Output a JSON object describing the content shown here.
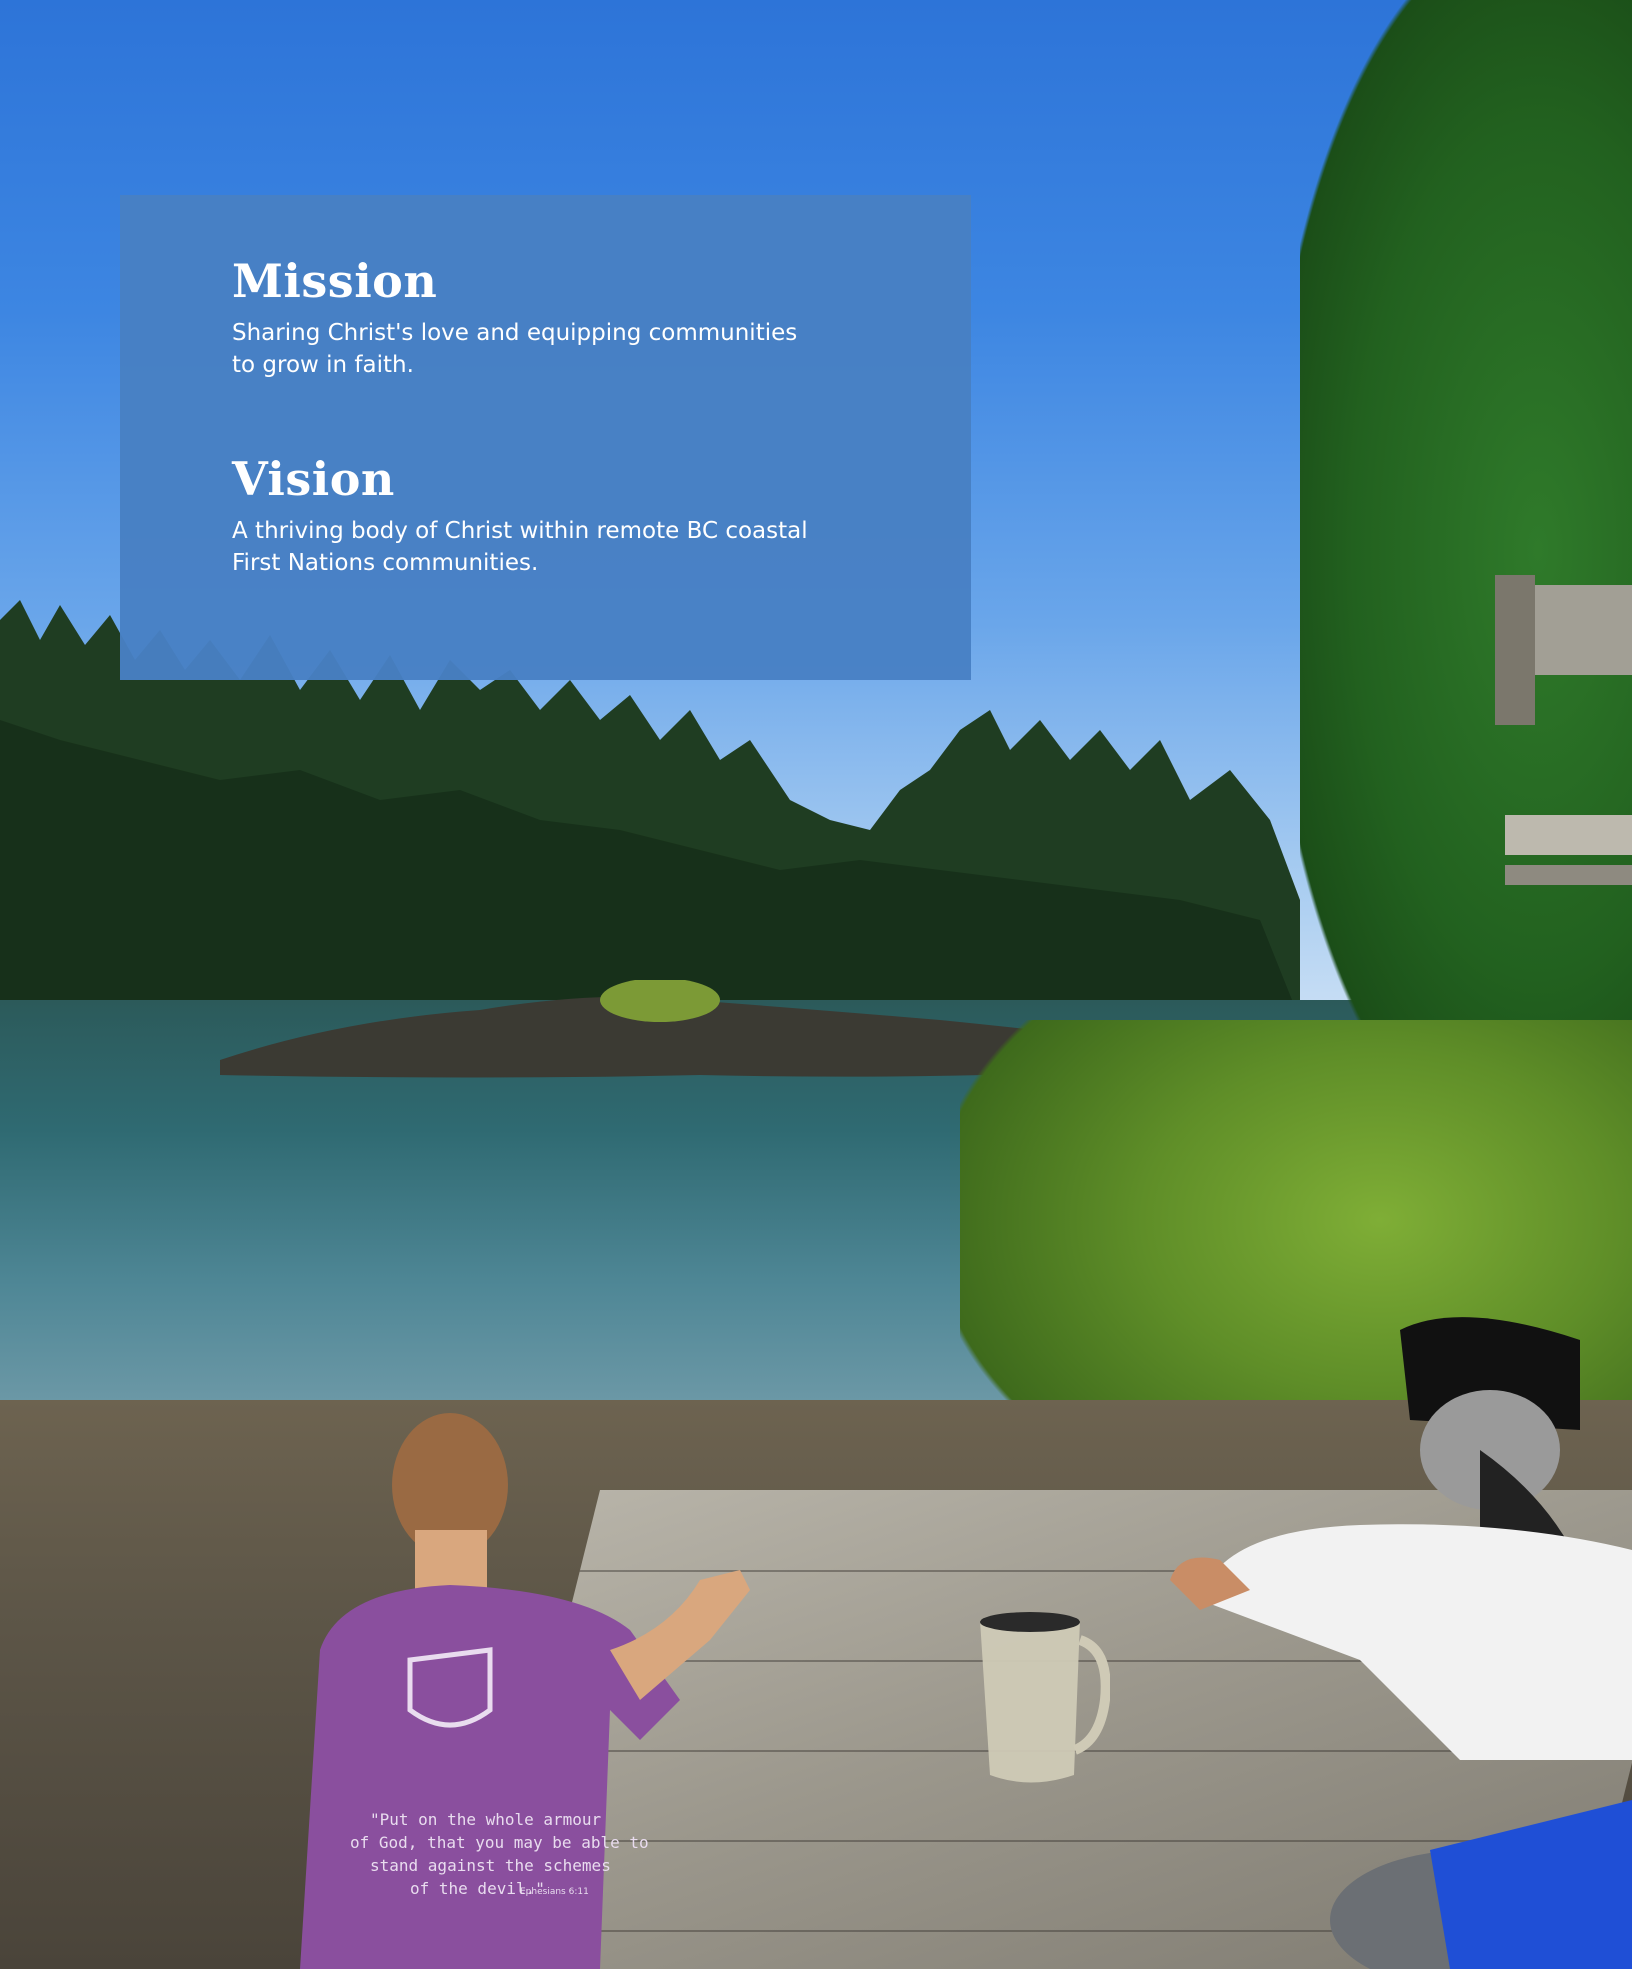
{
  "mission": {
    "heading": "Mission",
    "text_line1": "Sharing Christ's love and equipping communities",
    "text_line2": "to grow in faith."
  },
  "vision": {
    "heading": "Vision",
    "text_line1": "A thriving body of Christ within remote BC coastal",
    "text_line2": "First Nations communities."
  },
  "photo": {
    "shirt_quote_line1": "\"Put on the whole armour",
    "shirt_quote_line2": "of God, that you may be able to",
    "shirt_quote_line3": "stand against the schemes",
    "shirt_quote_line4": "of the devil.\"",
    "shirt_quote_ref": "Ephesians 6:11"
  },
  "colors": {
    "panel": "#4880c4",
    "sky": "#3d86e2",
    "shirt": "#8a4f9e"
  }
}
